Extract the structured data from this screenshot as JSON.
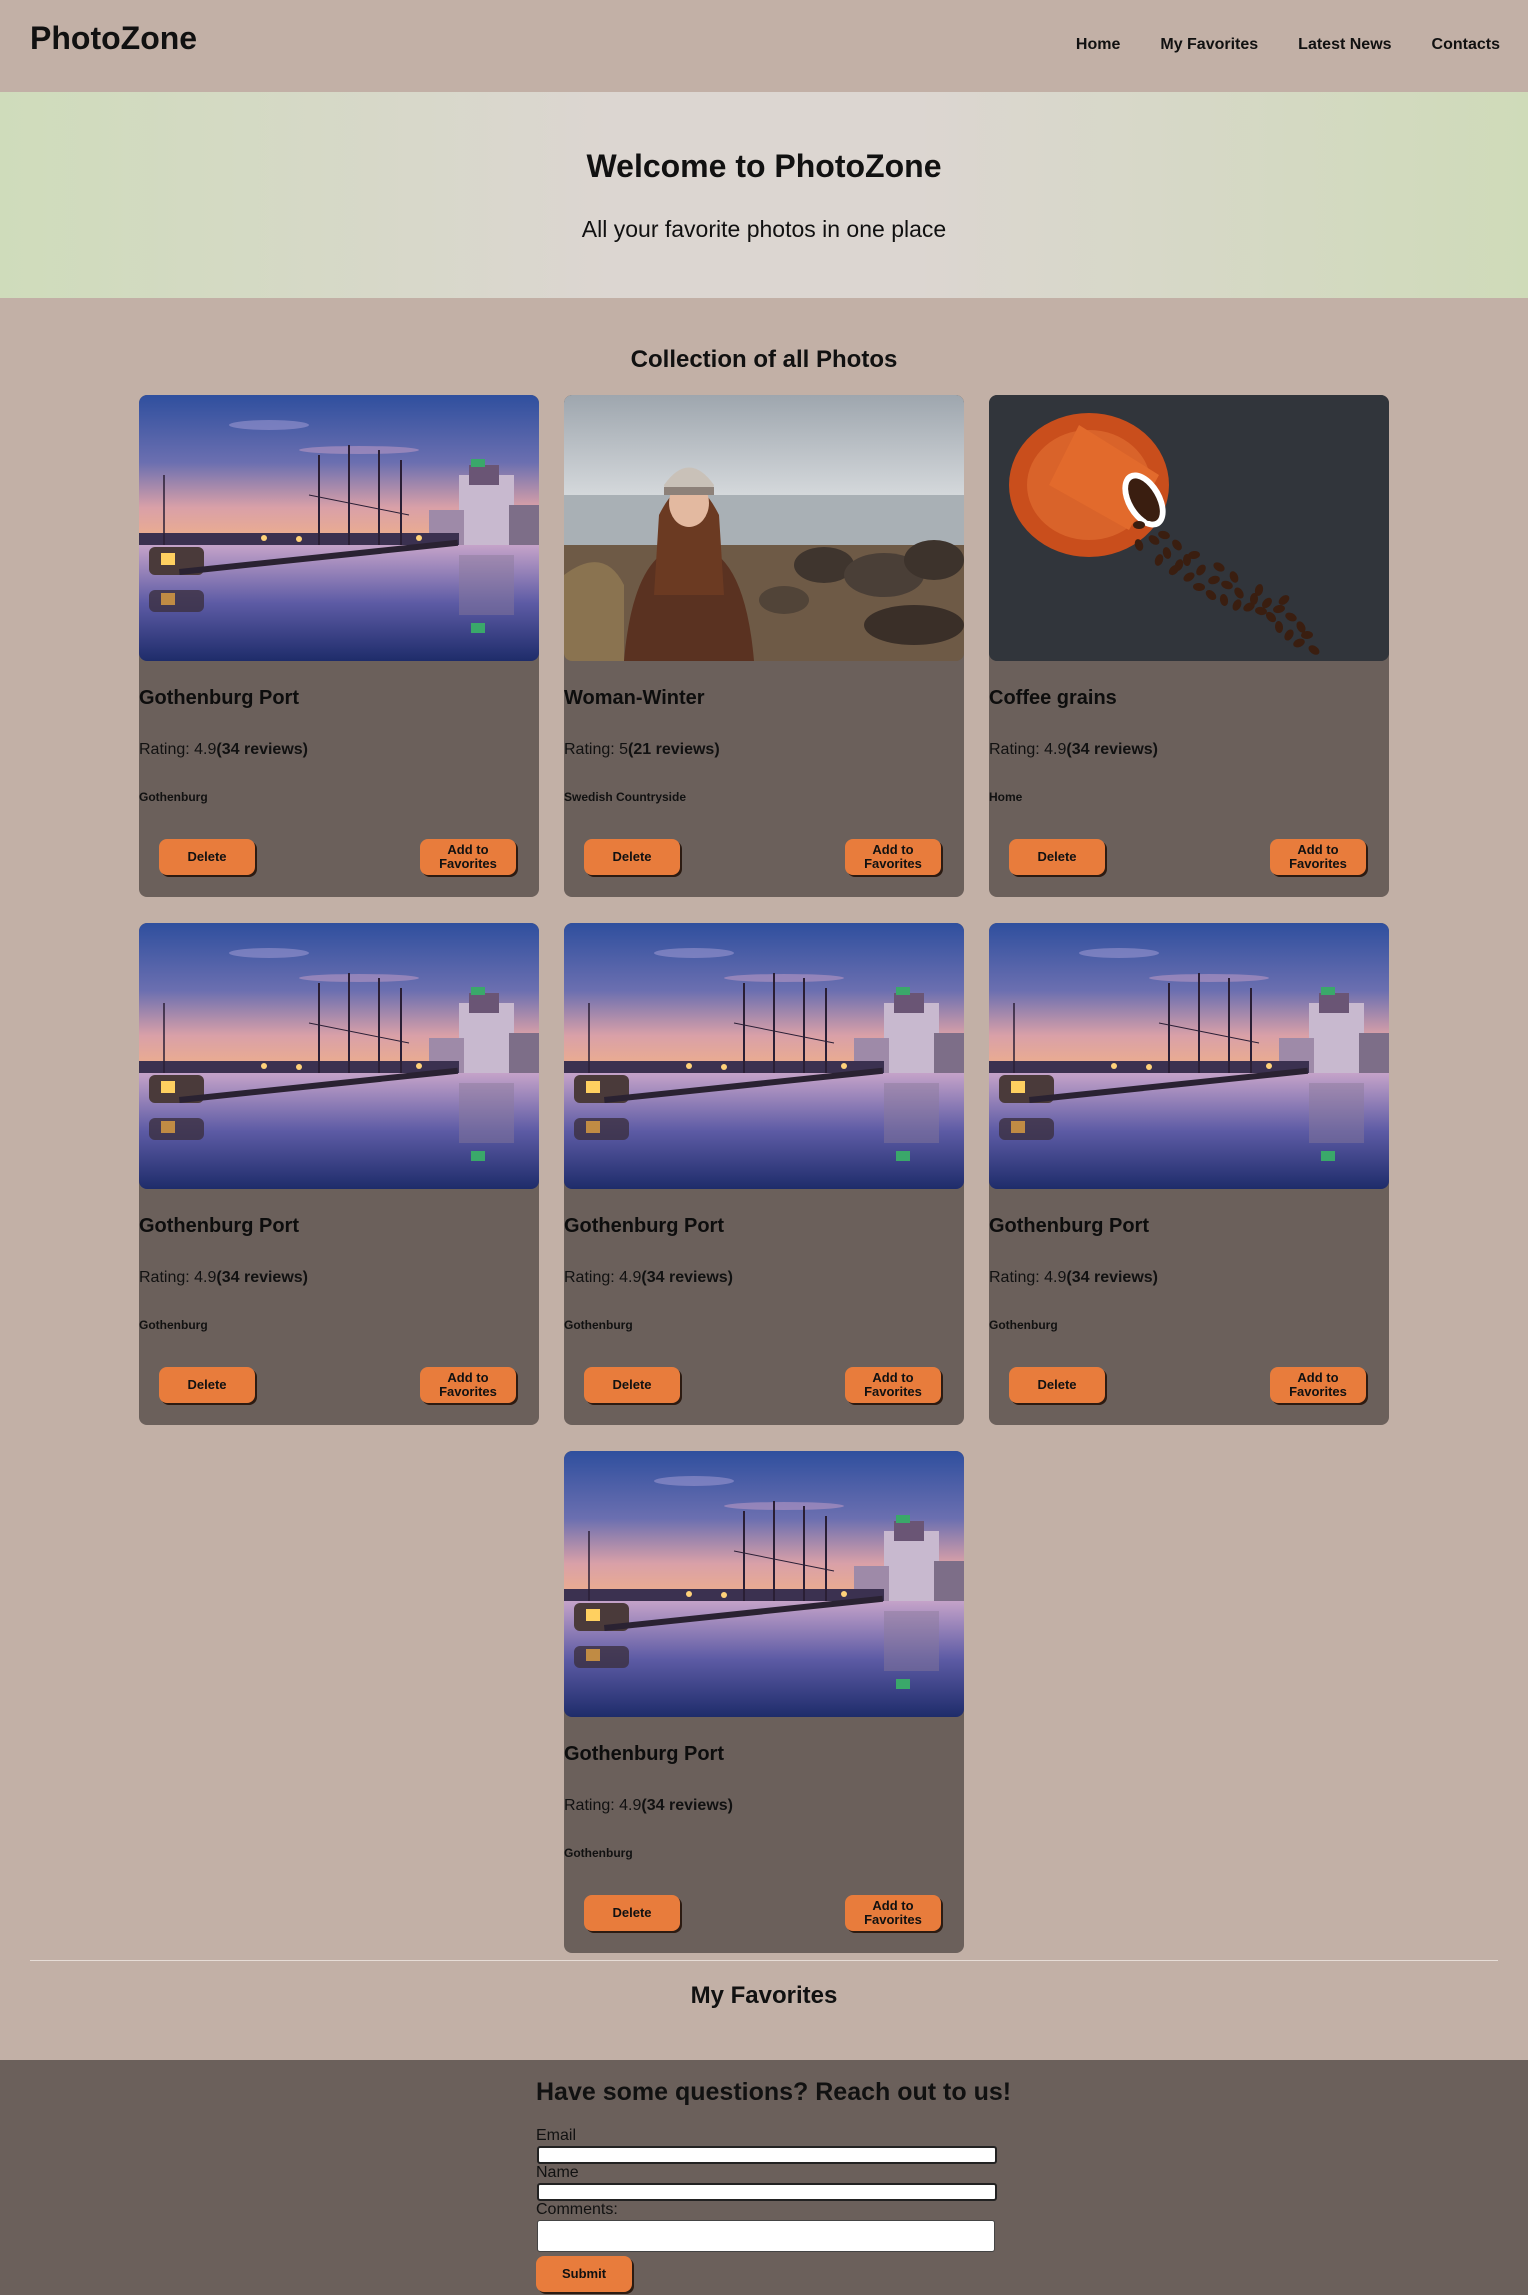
{
  "header": {
    "brand": "PhotoZone",
    "nav": [
      "Home",
      "My Favorites",
      "Latest News",
      "Contacts"
    ]
  },
  "hero": {
    "title": "Welcome to PhotoZone",
    "subtitle": "All your favorite photos in one place"
  },
  "collection": {
    "title": "Collection of all Photos",
    "rating_prefix": "Rating: ",
    "delete_label": "Delete",
    "favorite_label": "Add to Favorites",
    "cards": [
      {
        "title": "Gothenburg Port",
        "rating": "4.9",
        "reviews": "(34 reviews)",
        "location": "Gothenburg",
        "image": "harbor"
      },
      {
        "title": "Woman-Winter",
        "rating": "5",
        "reviews": "(21 reviews)",
        "location": "Swedish Countryside",
        "image": "woman"
      },
      {
        "title": "Coffee grains",
        "rating": "4.9",
        "reviews": "(34 reviews)",
        "location": "Home",
        "image": "coffee"
      },
      {
        "title": "Gothenburg Port",
        "rating": "4.9",
        "reviews": "(34 reviews)",
        "location": "Gothenburg",
        "image": "harbor"
      },
      {
        "title": "Gothenburg Port",
        "rating": "4.9",
        "reviews": "(34 reviews)",
        "location": "Gothenburg",
        "image": "harbor"
      },
      {
        "title": "Gothenburg Port",
        "rating": "4.9",
        "reviews": "(34 reviews)",
        "location": "Gothenburg",
        "image": "harbor"
      },
      {
        "title": "Gothenburg Port",
        "rating": "4.9",
        "reviews": "(34 reviews)",
        "location": "Gothenburg",
        "image": "harbor"
      }
    ]
  },
  "favorites": {
    "title": "My Favorites"
  },
  "contact": {
    "title": "Have some questions? Reach out to us!",
    "email_label": "Email",
    "name_label": "Name",
    "comments_label": "Comments:",
    "submit_label": "Submit"
  },
  "colors": {
    "background": "#c2b0a6",
    "card": "#6b605b",
    "button": "#e87c3c"
  }
}
